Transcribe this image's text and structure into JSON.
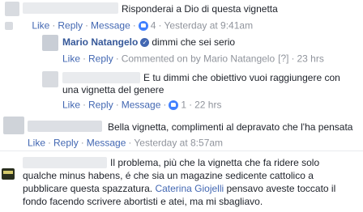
{
  "comments": [
    {
      "text": "Risponderai a Dio di questa vignetta",
      "actions": {
        "like": "Like",
        "reply": "Reply",
        "message": "Message",
        "count": "4",
        "time": "Yesterday at 9:41am"
      }
    },
    {
      "author": "Mario Natangelo",
      "text": "dimmi che sei serio",
      "actions": {
        "like": "Like",
        "reply": "Reply",
        "commented_on": "Commented on by Mario Natangelo",
        "help": "[?]",
        "time": "23 hrs"
      }
    },
    {
      "text_line1": "E tu dimmi che obiettivo vuoi raggiungere con",
      "text_line2": "una vignetta del genere",
      "actions": {
        "like": "Like",
        "reply": "Reply",
        "message": "Message",
        "count": "1",
        "time": "22 hrs"
      }
    },
    {
      "text": "Bella vignetta, complimenti al depravato che l'ha pensata",
      "actions": {
        "like": "Like",
        "reply": "Reply",
        "message": "Message",
        "time": "Yesterday at 8:57am"
      }
    },
    {
      "text_line1": "Il problema, più che la vignetta che fa ridere solo",
      "text_line2": "qualche minus habens, é che sia un magazine sedicente cattolico a",
      "text_line3": "pubblicare questa spazzatura.",
      "mention": "Caterina Giojelli",
      "text_line3_after": "pensavo aveste toccato il",
      "text_line4": "fondo facendo scrivere abortisti e atei, ma mi sbagliavo."
    }
  ],
  "colors": {
    "link": "#4267b2",
    "meta": "#90949c",
    "text": "#1d2129",
    "like_bubble": "#4080ff"
  },
  "icons": [
    "verified-icon",
    "like-icon"
  ]
}
